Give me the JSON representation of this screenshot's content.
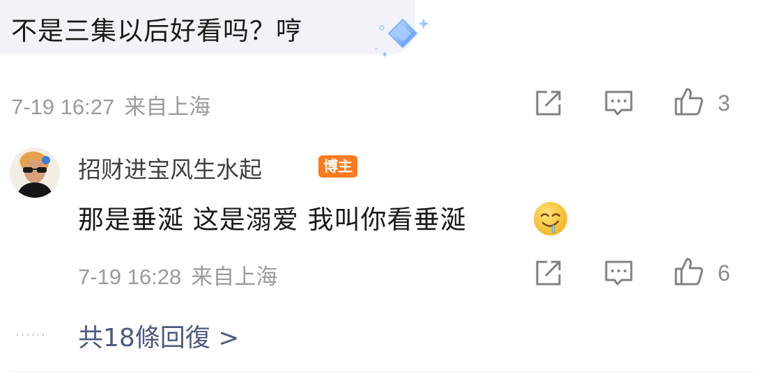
{
  "comment": {
    "text": "不是三集以后好看吗？哼",
    "time": "7-19 16:27",
    "location": "来自上海",
    "like_count": "3"
  },
  "reply": {
    "username": "招财进宝风生水起",
    "badge": "博主",
    "text": "那是垂涎 这是溺爱 我叫你看垂涎",
    "emoji": "drooling-face",
    "time": "7-19 16:28",
    "location": "来自上海",
    "like_count": "6"
  },
  "more_replies": {
    "dots": "······",
    "label": "共18條回復 >"
  },
  "icons": {
    "share": "share-icon",
    "comment": "comment-icon",
    "like": "thumbs-up-icon"
  },
  "colors": {
    "bubble_bg": "#f1f3f8",
    "badge_bg": "#ff7a1f",
    "link": "#4a5a80",
    "meta": "#9a9a9a"
  }
}
